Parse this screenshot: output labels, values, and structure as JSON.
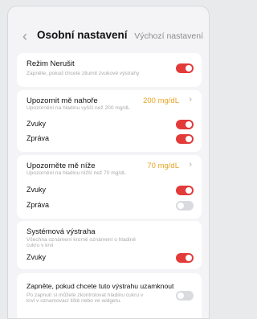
{
  "header": {
    "back_icon": "chevron-left-icon",
    "title": "Osobní nastavení",
    "reset_label": "Výchozí nastavení"
  },
  "dnd": {
    "title": "Režim Nerušit",
    "subtitle": "Zapněte, pokud chcete ztlumit zvukové výstrahy",
    "enabled": true
  },
  "high_alert": {
    "title": "Upozornit mě nahoře",
    "subtitle": "Upozornění na hladinu vyšší než 200 mg/dL",
    "value": "200 mg/dL",
    "sound_label": "Zvuky",
    "sound_enabled": true,
    "message_label": "Zpráva",
    "message_enabled": true
  },
  "low_alert": {
    "title": "Upozorněte mě níže",
    "subtitle": "Upozornění na hladinu nižší než 70 mg/dL",
    "value": "70 mg/dL",
    "sound_label": "Zvuky",
    "sound_enabled": true,
    "message_label": "Zpráva",
    "message_enabled": false
  },
  "system_alert": {
    "title": "Systémová výstraha",
    "subtitle_line1": "Všechna oznámení kromě oznámení o hladině",
    "subtitle_line2": "cukru v krvi",
    "sound_label": "Zvuky",
    "sound_enabled": true
  },
  "lock_screen": {
    "title": "Zapněte, pokud chcete tuto výstrahu uzamknout",
    "subtitle_line1": "Po zapnutí si můžete zkontrolovat hladinu cukru v",
    "subtitle_line2": "krvi v oznamovací liště nebo ve widgetu.",
    "enabled": false
  },
  "colors": {
    "accent": "#e23b3a",
    "value": "#e8a325",
    "toggle_off": "#dadbde"
  }
}
